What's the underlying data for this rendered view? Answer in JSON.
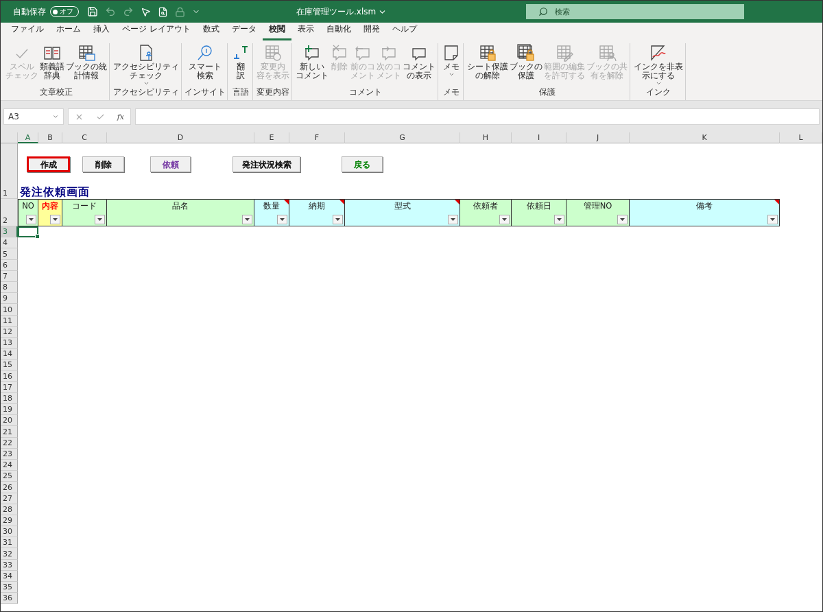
{
  "title_bar": {
    "autosave_label": "自動保存",
    "autosave_toggle": {
      "label": "オフ",
      "on": false
    },
    "file_name": "在庫管理ツール.xlsm",
    "search": {
      "placeholder": "検索"
    }
  },
  "menu_tabs": [
    {
      "label": "ファイル",
      "selected": false
    },
    {
      "label": "ホーム",
      "selected": false
    },
    {
      "label": "挿入",
      "selected": false
    },
    {
      "label": "ページ レイアウト",
      "selected": false
    },
    {
      "label": "数式",
      "selected": false
    },
    {
      "label": "データ",
      "selected": false
    },
    {
      "label": "校閲",
      "selected": true
    },
    {
      "label": "表示",
      "selected": false
    },
    {
      "label": "自動化",
      "selected": false
    },
    {
      "label": "開発",
      "selected": false
    },
    {
      "label": "ヘルプ",
      "selected": false
    }
  ],
  "ribbon_groups": [
    {
      "label": "文章校正",
      "commands": [
        {
          "kind": "spell",
          "lines": [
            "スペル",
            "チェック"
          ],
          "disabled": true,
          "dropdown": false
        },
        {
          "kind": "book",
          "lines": [
            "類義語",
            "辞典"
          ],
          "disabled": false,
          "dropdown": false
        },
        {
          "kind": "stats",
          "lines": [
            "ブックの統",
            "計情報"
          ],
          "disabled": false,
          "dropdown": false
        }
      ]
    },
    {
      "label": "アクセシビリティ",
      "commands": [
        {
          "kind": "accessibility",
          "lines": [
            "アクセシビリティ",
            "チェック"
          ],
          "disabled": false,
          "dropdown": true
        }
      ]
    },
    {
      "label": "インサイト",
      "commands": [
        {
          "kind": "lookup",
          "lines": [
            "スマート",
            "検索"
          ],
          "disabled": false,
          "dropdown": false
        }
      ]
    },
    {
      "label": "言語",
      "commands": [
        {
          "kind": "translate",
          "lines": [
            "翻",
            "訳"
          ],
          "disabled": false,
          "dropdown": false
        }
      ]
    },
    {
      "label": "変更内容",
      "commands": [
        {
          "kind": "changes",
          "lines": [
            "変更内",
            "容を表示"
          ],
          "disabled": true,
          "dropdown": false
        }
      ]
    },
    {
      "label": "コメント",
      "commands": [
        {
          "kind": "comment-new",
          "lines": [
            "新しい",
            "コメント"
          ],
          "disabled": false,
          "dropdown": false
        },
        {
          "kind": "comment-delete",
          "lines": [
            "削除"
          ],
          "disabled": true,
          "dropdown": false
        },
        {
          "kind": "comment-prev",
          "lines": [
            "前のコ",
            "メント"
          ],
          "disabled": true,
          "dropdown": false
        },
        {
          "kind": "comment-next",
          "lines": [
            "次のコ",
            "メント"
          ],
          "disabled": true,
          "dropdown": false
        },
        {
          "kind": "comment",
          "lines": [
            "コメント",
            "の表示"
          ],
          "disabled": false,
          "dropdown": false
        }
      ]
    },
    {
      "label": "メモ",
      "commands": [
        {
          "kind": "note",
          "lines": [
            "メモ"
          ],
          "disabled": false,
          "dropdown": true
        }
      ]
    },
    {
      "label": "保護",
      "commands": [
        {
          "kind": "sheet-lock",
          "lines": [
            "シート保護",
            "の解除"
          ],
          "disabled": false,
          "dropdown": false
        },
        {
          "kind": "book-lock",
          "lines": [
            "ブックの",
            "保護"
          ],
          "disabled": false,
          "dropdown": false
        },
        {
          "kind": "sheet-edit",
          "lines": [
            "範囲の編集",
            "を許可する"
          ],
          "disabled": true,
          "dropdown": false
        },
        {
          "kind": "sheet-user",
          "lines": [
            "ブックの共",
            "有を解除"
          ],
          "disabled": true,
          "dropdown": false
        }
      ]
    },
    {
      "label": "インク",
      "commands": [
        {
          "kind": "ink",
          "lines": [
            "インクを非表",
            "示にする"
          ],
          "disabled": false,
          "dropdown": true
        }
      ]
    }
  ],
  "formula_bar": {
    "name_box": "A3",
    "function_label": "fx"
  },
  "sheet": {
    "columns": [
      {
        "label": "A",
        "selected": true
      },
      {
        "label": "B",
        "selected": false
      },
      {
        "label": "C",
        "selected": false
      },
      {
        "label": "D",
        "selected": false
      },
      {
        "label": "E",
        "selected": false
      },
      {
        "label": "F",
        "selected": false
      },
      {
        "label": "G",
        "selected": false
      },
      {
        "label": "H",
        "selected": false
      },
      {
        "label": "I",
        "selected": false
      },
      {
        "label": "J",
        "selected": false
      },
      {
        "label": "K",
        "selected": false
      },
      {
        "label": "L",
        "selected": false
      }
    ],
    "rows": [
      {
        "label": "1",
        "selected": false
      },
      {
        "label": "2",
        "selected": false
      },
      {
        "label": "3",
        "selected": true
      },
      {
        "label": "4",
        "selected": false
      },
      {
        "label": "5",
        "selected": false
      },
      {
        "label": "6",
        "selected": false
      },
      {
        "label": "7",
        "selected": false
      },
      {
        "label": "8",
        "selected": false
      },
      {
        "label": "9",
        "selected": false
      },
      {
        "label": "10",
        "selected": false
      },
      {
        "label": "11",
        "selected": false
      },
      {
        "label": "12",
        "selected": false
      },
      {
        "label": "13",
        "selected": false
      },
      {
        "label": "14",
        "selected": false
      },
      {
        "label": "15",
        "selected": false
      },
      {
        "label": "16",
        "selected": false
      },
      {
        "label": "17",
        "selected": false
      },
      {
        "label": "18",
        "selected": false
      },
      {
        "label": "19",
        "selected": false
      },
      {
        "label": "20",
        "selected": false
      },
      {
        "label": "21",
        "selected": false
      },
      {
        "label": "22",
        "selected": false
      },
      {
        "label": "23",
        "selected": false
      },
      {
        "label": "24",
        "selected": false
      },
      {
        "label": "25",
        "selected": false
      },
      {
        "label": "26",
        "selected": false
      },
      {
        "label": "27",
        "selected": false
      },
      {
        "label": "28",
        "selected": false
      },
      {
        "label": "29",
        "selected": false
      },
      {
        "label": "30",
        "selected": false
      },
      {
        "label": "31",
        "selected": false
      },
      {
        "label": "32",
        "selected": false
      },
      {
        "label": "33",
        "selected": false
      },
      {
        "label": "34",
        "selected": false
      },
      {
        "label": "35",
        "selected": false
      },
      {
        "label": "36",
        "selected": false
      }
    ],
    "buttons": [
      {
        "label": "作成",
        "selected": true,
        "color": "#000000"
      },
      {
        "label": "削除",
        "selected": false,
        "color": "#000000"
      },
      {
        "label": "依頼",
        "selected": false,
        "color": "#7030a0"
      },
      {
        "label": "発注状況検索",
        "selected": false,
        "color": "#000000"
      },
      {
        "label": "戻る",
        "selected": false,
        "color": "#008000"
      }
    ],
    "title": "発注依頼画面",
    "header_cells": [
      {
        "label": "NO",
        "color": "#ccffcc",
        "highlight": false,
        "comment": false
      },
      {
        "label": "内容",
        "color": "#ffff99",
        "highlight": true,
        "comment": false
      },
      {
        "label": "コード",
        "color": "#ccffcc",
        "highlight": false,
        "comment": false
      },
      {
        "label": "品名",
        "color": "#ccffcc",
        "highlight": false,
        "comment": false
      },
      {
        "label": "数量",
        "color": "#ccffff",
        "highlight": false,
        "comment": true
      },
      {
        "label": "納期",
        "color": "#ccffff",
        "highlight": false,
        "comment": true
      },
      {
        "label": "型式",
        "color": "#ccffff",
        "highlight": false,
        "comment": true
      },
      {
        "label": "依頼者",
        "color": "#ccffcc",
        "highlight": false,
        "comment": false
      },
      {
        "label": "依頼日",
        "color": "#ccffcc",
        "highlight": false,
        "comment": false
      },
      {
        "label": "管理NO",
        "color": "#ccffcc",
        "highlight": false,
        "comment": false
      },
      {
        "label": "備考",
        "color": "#ccffff",
        "highlight": false,
        "comment": true
      }
    ]
  }
}
